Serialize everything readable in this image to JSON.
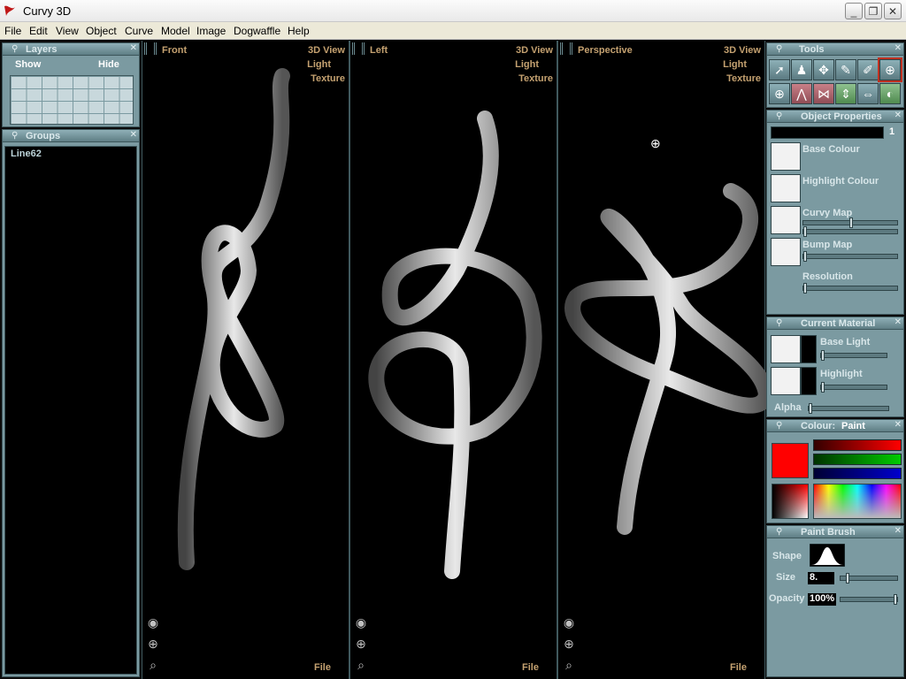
{
  "window": {
    "title": "Curvy 3D",
    "min": "_",
    "max": "❐",
    "close": "✕"
  },
  "menu": [
    "File",
    "Edit",
    "View",
    "Object",
    "Curve",
    "Model",
    "Image",
    "Dogwaffle",
    "Help"
  ],
  "layers": {
    "title": "Layers",
    "show": "Show",
    "hide": "Hide"
  },
  "groups": {
    "title": "Groups",
    "items": [
      "Line62"
    ]
  },
  "viewports": [
    {
      "name": "Front",
      "view": "3D View",
      "light": "Light",
      "texture": "Texture",
      "file": "File"
    },
    {
      "name": "Left",
      "view": "3D View",
      "light": "Light",
      "texture": "Texture",
      "file": "File"
    },
    {
      "name": "Perspective",
      "view": "3D View",
      "light": "Light",
      "texture": "Texture",
      "file": "File"
    }
  ],
  "tools": {
    "title": "Tools"
  },
  "object_properties": {
    "title": "Object Properties",
    "value": "1",
    "base_colour": "Base Colour",
    "highlight_colour": "Highlight Colour",
    "curvy_map": "Curvy Map",
    "bump_map": "Bump Map",
    "resolution": "Resolution"
  },
  "current_material": {
    "title": "Current Material",
    "base_light": "Base Light",
    "highlight": "Highlight",
    "alpha": "Alpha"
  },
  "colour": {
    "title": "Colour:",
    "mode": "Paint",
    "swatch": "#ff0000"
  },
  "paint_brush": {
    "title": "Paint Brush",
    "shape": "Shape",
    "size": "Size",
    "size_value": "8.",
    "opacity": "Opacity",
    "opacity_value": "100%"
  },
  "colors": {
    "panel": "#7b9aa1",
    "viewport_label": "#c4a170"
  }
}
